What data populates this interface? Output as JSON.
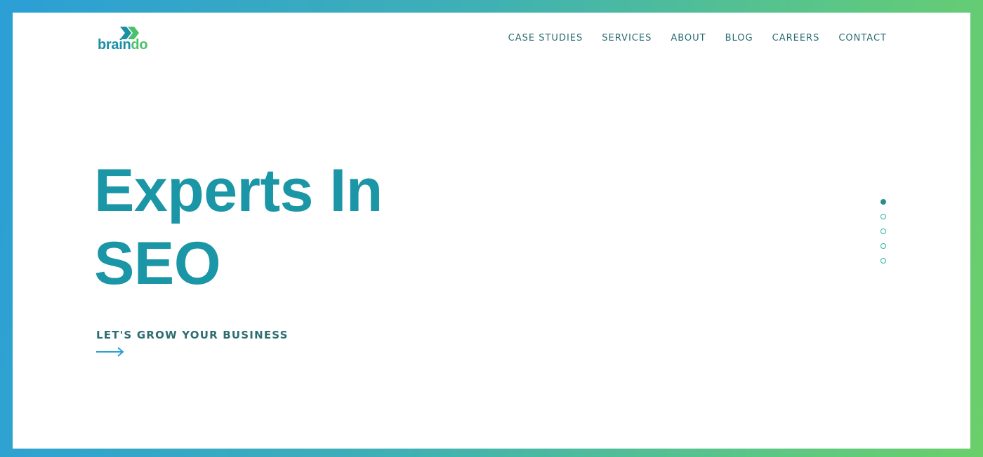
{
  "brand": {
    "logo_text_1": "brain",
    "logo_text_2": "do",
    "colors": {
      "primary": "#1b96a6",
      "accent_green": "#4cc06a",
      "nav_text": "#2a6c73",
      "gradient_start": "#2b9fd6",
      "gradient_end": "#6bcf6a"
    }
  },
  "nav": {
    "items": [
      {
        "label": "CASE STUDIES"
      },
      {
        "label": "SERVICES"
      },
      {
        "label": "ABOUT"
      },
      {
        "label": "BLOG"
      },
      {
        "label": "CAREERS"
      },
      {
        "label": "CONTACT"
      }
    ]
  },
  "hero": {
    "title_line_1": "Experts In",
    "title_line_2": "SEO",
    "cta_label": "LET'S GROW YOUR BUSINESS",
    "cta_icon": "arrow-right-icon"
  },
  "slider": {
    "total": 5,
    "active_index": 0
  }
}
